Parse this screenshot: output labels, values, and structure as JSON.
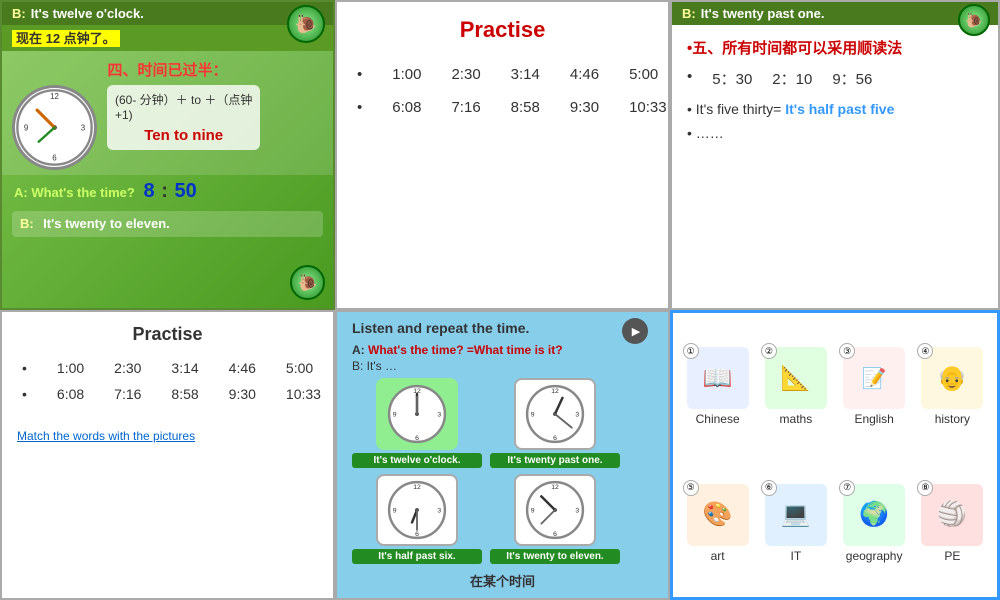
{
  "cell1": {
    "header_b": "B:",
    "header_text": "It's twelve o'clock.",
    "header_chinese": "现在 12 点钟了。",
    "formula_line1": "(60- 分钟）＋ to ＋（点钟",
    "formula_line2": "+1)",
    "ten_to": "Ten   to   nine",
    "qa_a": "A: What's the time?",
    "qa_num1": "8",
    "qa_colon": ":",
    "qa_num2": "50",
    "answer_b": "B:",
    "answer_text": "It's twenty to eleven.",
    "section_label": "四、时间已过半："
  },
  "cell2": {
    "title": "Practise",
    "row1": [
      "1:00",
      "2:30",
      "3:14",
      "4:46",
      "5:00"
    ],
    "row2": [
      "6:08",
      "7:16",
      "8:58",
      "9:30",
      "10:33"
    ]
  },
  "cell3": {
    "header_b": "B:",
    "header_text": "It's twenty past one.",
    "section_title": "•五、所有时间都可以采用顺读法",
    "bullet1_items": [
      "5：30",
      "2：10",
      "9：56"
    ],
    "it_five_text": "• It's five thirty=",
    "it_five_blue": "It's half past five",
    "dots": "• ……"
  },
  "cell4": {
    "title": "Practise",
    "row1": [
      "1:00",
      "2:30",
      "3:14",
      "4:46",
      "5:00"
    ],
    "row2": [
      "6:08",
      "7:16",
      "8:58",
      "9:30",
      "10:33"
    ],
    "bottom_link": "Match the words with the pictures"
  },
  "cell5": {
    "header": "Listen and repeat the time.",
    "qa_a": "A:",
    "qa_a_red": "What's the time?",
    "qa_a_eq": "=What time is it?",
    "qa_b": "B: It's …",
    "clocks": [
      {
        "label": "It's twelve o'clock.",
        "time": "12:00"
      },
      {
        "label": "It's twenty past one.",
        "time": "1:20"
      },
      {
        "label": "It's half past six.",
        "time": "6:30"
      },
      {
        "label": "It's twenty to eleven.",
        "time": "10:40"
      }
    ],
    "bottom": "在某个时间"
  },
  "cell6": {
    "subjects": [
      {
        "num": "①",
        "name": "Chinese",
        "color": "#4169E1"
      },
      {
        "num": "②",
        "name": "maths",
        "color": "#228B22"
      },
      {
        "num": "③",
        "name": "English",
        "color": "#DC143C"
      },
      {
        "num": "④",
        "name": "history",
        "color": "#8B4513"
      },
      {
        "num": "⑤",
        "name": "art",
        "color": "#FF8C00"
      },
      {
        "num": "⑥",
        "name": "IT",
        "color": "#4682B4"
      },
      {
        "num": "⑦",
        "name": "geography",
        "color": "#2E8B57"
      },
      {
        "num": "⑧",
        "name": "PE",
        "color": "#8B0000"
      }
    ]
  }
}
